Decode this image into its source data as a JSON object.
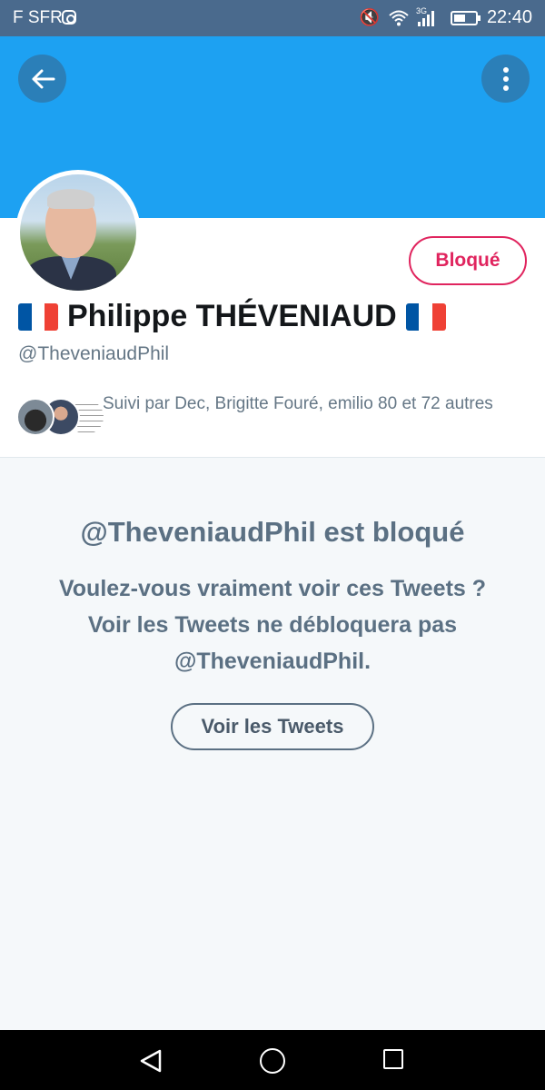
{
  "status_bar": {
    "carrier": "F SFR",
    "network": "3G",
    "time": "22:40",
    "icons": [
      "instagram-icon",
      "mute-icon",
      "wifi-icon",
      "signal-icon",
      "battery-icon"
    ]
  },
  "header": {
    "banner_color": "#1da1f2",
    "back_icon": "arrow-left-icon",
    "more_icon": "more-vertical-icon"
  },
  "profile": {
    "display_name": "Philippe THÉVENIAUD",
    "flag_icon": "flag-fr-icon",
    "handle": "@TheveniaudPhil",
    "blocked_label": "Bloqué",
    "followed_by": "Suivi par Dec, Brigitte Fouré, emilio 80 et 72 autres"
  },
  "blocked_notice": {
    "title": "@TheveniaudPhil est bloqué",
    "message": "Voulez-vous vraiment voir ces Tweets ? Voir les Tweets ne débloquera pas @TheveniaudPhil.",
    "button_label": "Voir les Tweets"
  },
  "colors": {
    "accent": "#1da1f2",
    "blocked_red": "#e0245e",
    "muted_text": "#657786"
  }
}
